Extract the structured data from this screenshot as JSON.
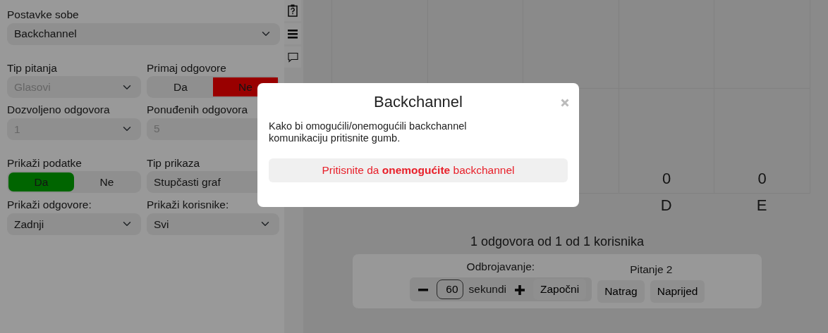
{
  "sidebar": {
    "room_settings": {
      "label": "Postavke sobe",
      "value": "Backchannel"
    },
    "rows": [
      [
        {
          "kind": "select",
          "label": "Tip pitanja",
          "value": "Glasovi",
          "disabled": true
        },
        {
          "kind": "toggle",
          "label": "Primaj odgovore",
          "options": [
            {
              "label": "Da",
              "selected": false
            },
            {
              "label": "Ne",
              "selected": true
            }
          ]
        }
      ],
      [
        {
          "kind": "select",
          "label": "Dozvoljeno odgovora",
          "value": "1",
          "disabled": true
        },
        {
          "kind": "input",
          "label": "Ponuđenih odgovora",
          "value": "5",
          "disabled": true
        }
      ],
      [
        {
          "kind": "toggle",
          "label": "Prikaži podatke",
          "options": [
            {
              "label": "Da",
              "selected": true
            },
            {
              "label": "Ne",
              "selected": false
            }
          ]
        },
        {
          "kind": "select",
          "label": "Tip prikaza",
          "value": "Stupčasti graf",
          "disabled": false
        }
      ],
      [
        {
          "kind": "select",
          "label": "Prikaži odgovore:",
          "value": "Zadnji",
          "disabled": false
        },
        {
          "kind": "select",
          "label": "Prikaži korisnike:",
          "value": "Svi",
          "disabled": false
        }
      ]
    ]
  },
  "chart": {
    "columns": [
      {
        "label": "D",
        "value": "0"
      },
      {
        "label": "E",
        "value": "0"
      }
    ]
  },
  "summary": "1 odgovora od 1 od 1 korisnika",
  "countdown": {
    "label": "Odbrojavanje:",
    "seconds": "60",
    "unit": "sekundi",
    "start": "Započni"
  },
  "question": {
    "label": "Pitanje 2",
    "buttons": [
      "Natrag",
      "Naprijed"
    ]
  },
  "modal": {
    "title": "Backchannel",
    "body": "Kako bi omogućili/onemogućili backchannel komunikaciju pritisnite gumb.",
    "button": "Pritisnite da **onemogućite** backchannel"
  }
}
